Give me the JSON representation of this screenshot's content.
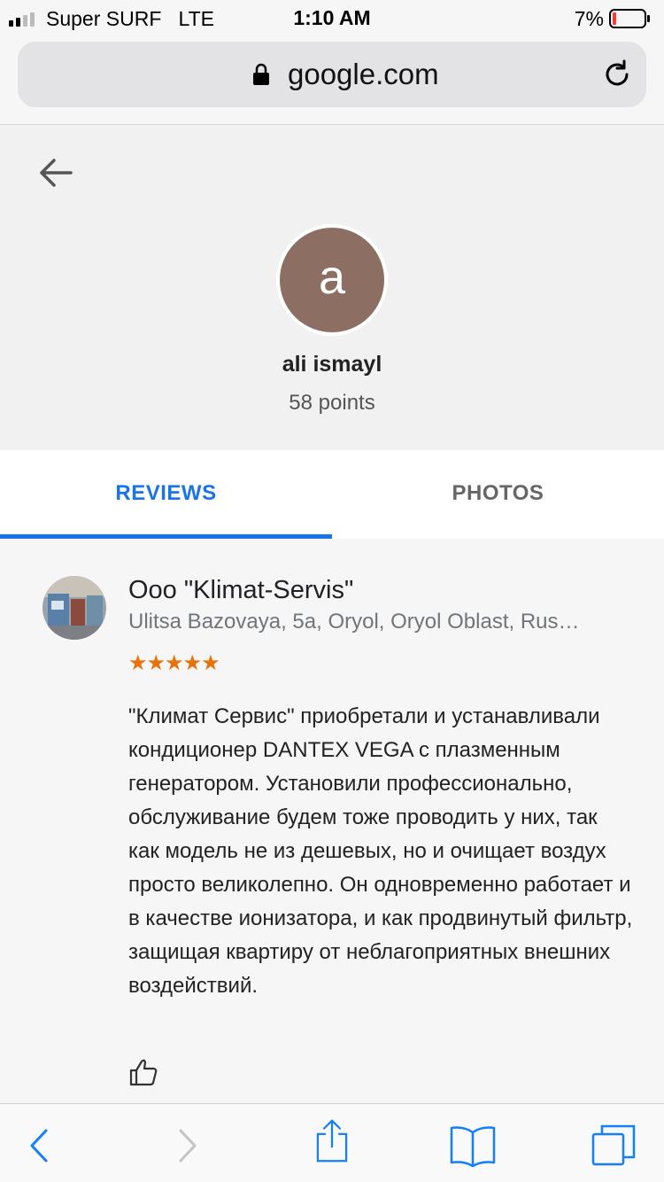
{
  "status_bar": {
    "carrier": "Super SURF   LTE",
    "time": "1:10 AM",
    "battery_percent": "7%"
  },
  "url_bar": {
    "domain": "google.com"
  },
  "profile": {
    "avatar_letter": "a",
    "avatar_color": "#8d6e63",
    "name": "ali ismayl",
    "points": "58 points"
  },
  "tabs": [
    {
      "label": "REVIEWS",
      "active": true
    },
    {
      "label": "PHOTOS",
      "active": false
    }
  ],
  "review": {
    "place_name": "Ooo \"Klimat-Servis\"",
    "address": "Ulitsa Bazovaya, 5a, Oryol, Oryol Oblast, Rus…",
    "stars": "★★★★★",
    "rating": 5,
    "text": "\"Климат Сервис\" приобретали и устанавливали кондиционер DANTEX VEGA с плазменным генератором. Установили профессионально, обслуживание будем тоже проводить у них, так как модель не из дешевых, но и очищает воздух просто великолепно. Он одновременно работает и в качестве ионизатора, и как продвинутый фильтр, защищая квартиру от неблагоприятных внешних воздействий."
  },
  "colors": {
    "accent": "#1a73e8",
    "star": "#e8710a",
    "ios_blue": "#147efb"
  }
}
